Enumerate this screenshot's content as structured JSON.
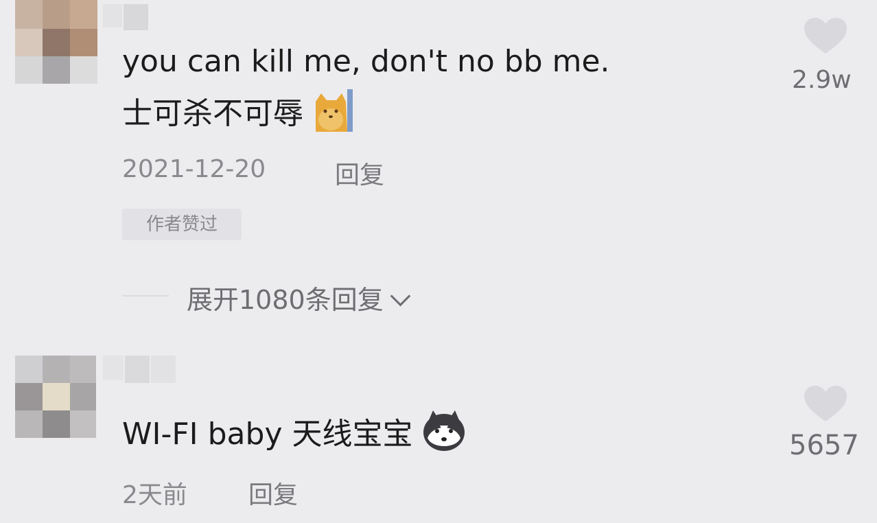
{
  "comments": [
    {
      "text_line1": "you can kill me, don't no bb me.",
      "text_line2": "士可杀不可辱",
      "emoji_icon": "shiba-peek-icon",
      "date": "2021-12-20",
      "reply_label": "回复",
      "badge": "作者赞过",
      "like_count": "2.9w",
      "expand_label": "展开1080条回复"
    },
    {
      "text": "WI-FI baby 天线宝宝",
      "emoji_icon": "husky-icon",
      "date": "2天前",
      "reply_label": "回复",
      "like_count": "5657"
    }
  ],
  "colors": {
    "background": "#ececef",
    "text": "#1b1b1b",
    "meta": "#8a8a8e",
    "heart": "#d9d9dd"
  }
}
